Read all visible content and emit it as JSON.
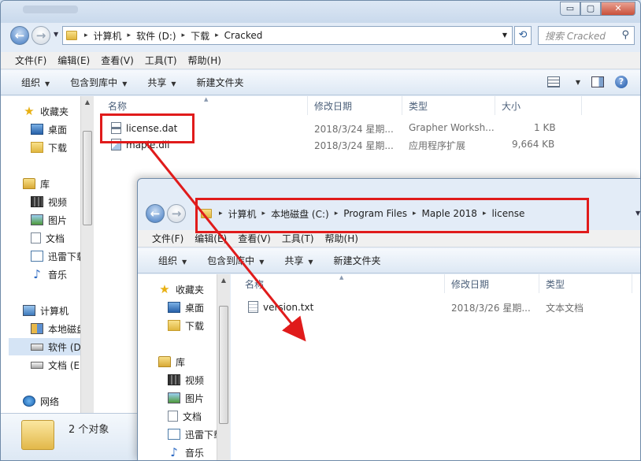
{
  "win1": {
    "caption_buttons": [
      "▭",
      "▢",
      "✕"
    ],
    "addr_parts": [
      "计算机",
      "软件 (D:)",
      "下载",
      "Cracked"
    ],
    "search_placeholder": "搜索 Cracked",
    "menu": [
      "文件(F)",
      "编辑(E)",
      "查看(V)",
      "工具(T)",
      "帮助(H)"
    ],
    "cmds": [
      "组织",
      "包含到库中",
      "共享",
      "新建文件夹"
    ],
    "nav": {
      "favorites": "收藏夹",
      "desktop": "桌面",
      "downloads": "下载",
      "library": "库",
      "video": "视频",
      "pictures": "图片",
      "docs": "文档",
      "xunlei": "迅雷下载",
      "music": "音乐",
      "computer": "计算机",
      "local_disk": "本地磁盘",
      "soft_d": "软件 (D",
      "docs_e": "文档 (E:",
      "network": "网络"
    },
    "columns": [
      "名称",
      "修改日期",
      "类型",
      "大小"
    ],
    "files": [
      {
        "name": "license.dat",
        "date": "2018/3/24 星期...",
        "type": "Grapher Worksh...",
        "size": "1 KB"
      },
      {
        "name": "maple.dll",
        "date": "2018/3/24 星期...",
        "type": "应用程序扩展",
        "size": "9,664 KB"
      }
    ],
    "status_count": "2 个对象"
  },
  "win2": {
    "addr_parts": [
      "计算机",
      "本地磁盘 (C:)",
      "Program Files",
      "Maple 2018",
      "license"
    ],
    "menu": [
      "文件(F)",
      "编辑(E)",
      "查看(V)",
      "工具(T)",
      "帮助(H)"
    ],
    "cmds": [
      "组织",
      "包含到库中",
      "共享",
      "新建文件夹"
    ],
    "nav": {
      "favorites": "收藏夹",
      "desktop": "桌面",
      "downloads": "下载",
      "library": "库",
      "video": "视频",
      "pictures": "图片",
      "docs": "文档",
      "xunlei": "迅雷下载",
      "music": "音乐"
    },
    "columns": [
      "名称",
      "修改日期",
      "类型"
    ],
    "files": [
      {
        "name": "version.txt",
        "date": "2018/3/26 星期...",
        "type": "文本文档"
      }
    ]
  },
  "colors": {
    "highlight": "#e01b1b",
    "window_bg": "#e3ecf7"
  }
}
